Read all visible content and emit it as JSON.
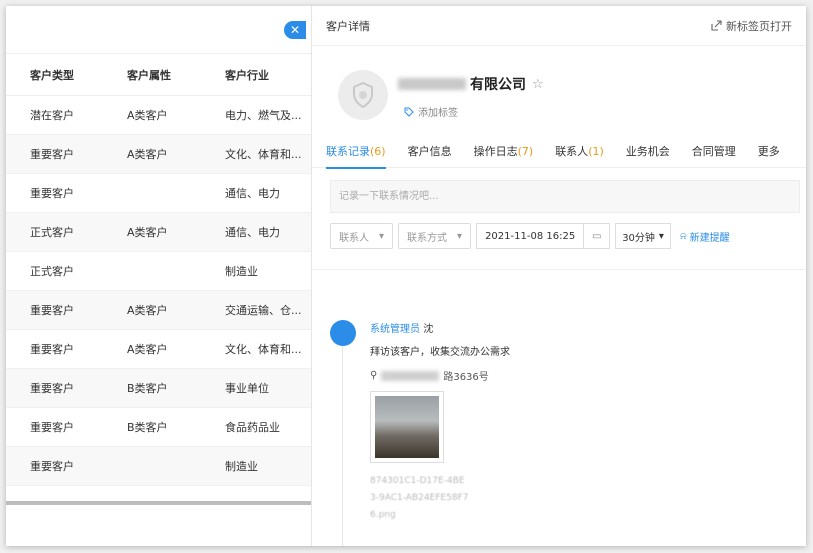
{
  "table": {
    "headers": [
      "客户类型",
      "客户属性",
      "客户行业"
    ],
    "rows": [
      [
        "潜在客户",
        "A类客户",
        "电力、燃气及..."
      ],
      [
        "重要客户",
        "A类客户",
        "文化、体育和..."
      ],
      [
        "重要客户",
        "",
        "通信、电力"
      ],
      [
        "正式客户",
        "A类客户",
        "通信、电力"
      ],
      [
        "正式客户",
        "",
        "制造业"
      ],
      [
        "重要客户",
        "A类客户",
        "交通运输、仓..."
      ],
      [
        "重要客户",
        "A类客户",
        "文化、体育和..."
      ],
      [
        "重要客户",
        "B类客户",
        "事业单位"
      ],
      [
        "重要客户",
        "B类客户",
        "食品药品业"
      ],
      [
        "重要客户",
        "",
        "制造业"
      ]
    ]
  },
  "panel": {
    "title": "客户详情",
    "open_new_tab": "新标签页打开",
    "company_name_suffix": "有限公司",
    "add_tag": "添加标签"
  },
  "tabs": [
    {
      "label": "联系记录",
      "count": "(6)"
    },
    {
      "label": "客户信息",
      "count": ""
    },
    {
      "label": "操作日志",
      "count": "(7)"
    },
    {
      "label": "联系人",
      "count": "(1)"
    },
    {
      "label": "业务机会",
      "count": ""
    },
    {
      "label": "合同管理",
      "count": ""
    },
    {
      "label": "更多",
      "count": ""
    }
  ],
  "note": {
    "placeholder": "记录一下联系情况吧..."
  },
  "filters": {
    "contact": "联系人",
    "method": "联系方式",
    "datetime": "2021-11-08 16:25",
    "duration": "30分钟",
    "new_reminder": "新建提醒"
  },
  "record": {
    "user": "系统管理员",
    "user_suffix": "沈",
    "text": "拜访该客户，收集交流办公需求",
    "address_suffix": "路3636号",
    "file_name": "874301C1-D17E-4BE3-9AC1-AB24EFE58F76.png"
  },
  "colors": {
    "accent": "#2b8de8",
    "count": "#e89a1b"
  }
}
